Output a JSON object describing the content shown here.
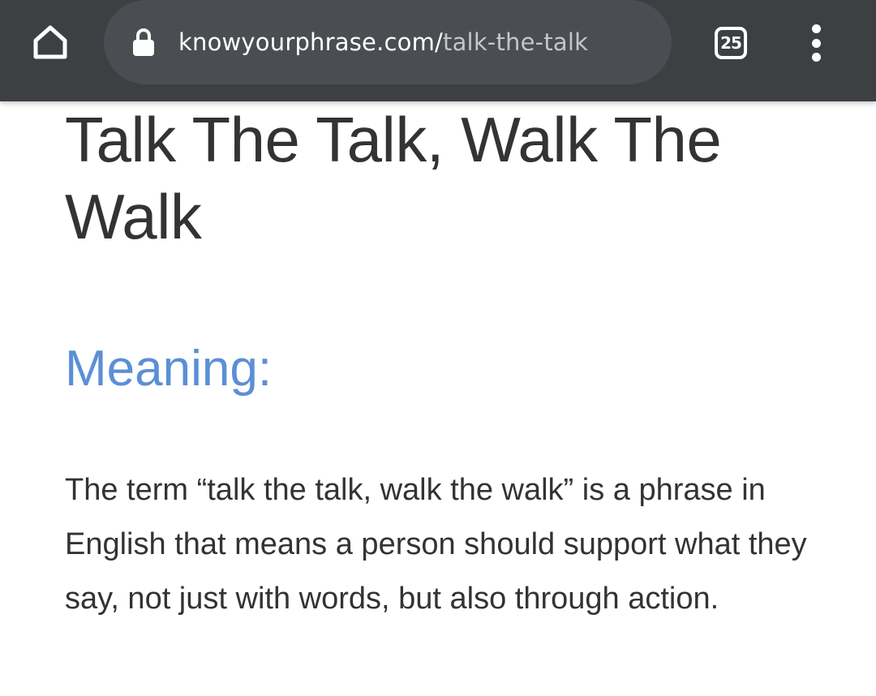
{
  "browser": {
    "url_domain": "knowyourphrase.com/",
    "url_path": "talk-the-talk",
    "tab_count": "25"
  },
  "article": {
    "title": "Talk The Talk, Walk The Walk",
    "section_heading": "Meaning:",
    "paragraph": "The term “talk the talk, walk the walk” is a phrase in English that means a person should support what they say, not just with words, but also through action."
  },
  "icons": {
    "home": "home-icon",
    "lock": "lock-icon",
    "tabs": "tab-switcher-icon",
    "menu": "more-vert-icon"
  },
  "colors": {
    "toolbar": "#3c4043",
    "omnibox": "#4a4d51",
    "heading_accent": "#5b8fd6",
    "text": "#333333"
  }
}
